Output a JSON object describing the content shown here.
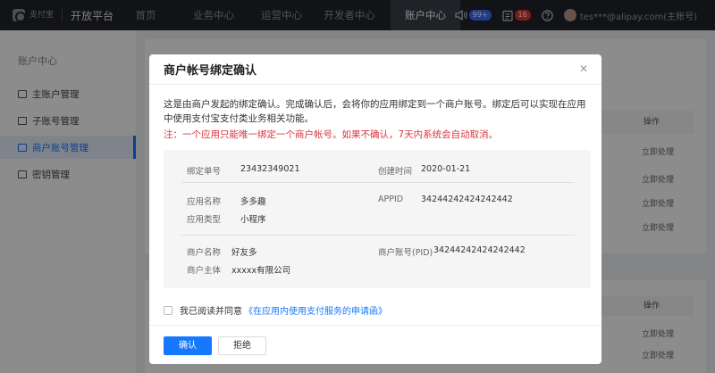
{
  "topbar": {
    "logo_text": "支付宝",
    "platform": "开放平台",
    "nav": [
      "首页",
      "业务中心",
      "运营中心",
      "开发者中心",
      "账户中心"
    ],
    "message_count": "99+",
    "todo_count": "16",
    "account": "tes***@alipay.com(主账号)"
  },
  "sidebar": {
    "title": "账户中心",
    "items": [
      "主账户管理",
      "子账号管理",
      "商户账号管理",
      "密钥管理"
    ]
  },
  "background": {
    "table_header": "操作",
    "row_action": "立即处理"
  },
  "modal": {
    "title": "商户帐号绑定确认",
    "intro": "这是由商户发起的绑定确认。完成确认后，会将你的应用绑定到一个商户账号。绑定后可以实现在应用中使用支付宝支付类业务相关功能。",
    "warning": "注：一个应用只能唯一绑定一个商户帐号。如果不确认，7天内系统会自动取消。",
    "fields": {
      "bind_no_label": "绑定单号",
      "bind_no": "23432349021",
      "created_label": "创建时间",
      "created": "2020-01-21",
      "app_name_label": "应用名称",
      "app_name": "多多趣",
      "appid_label": "APPID",
      "appid": "34244242424242442",
      "app_type_label": "应用类型",
      "app_type": "小程序",
      "merchant_name_label": "商户名称",
      "merchant_name": "好友多",
      "pid_label": "商户账号(PID)",
      "pid": "34244242424242442",
      "merchant_subject_label": "商户主体",
      "merchant_subject": "xxxxx有限公司"
    },
    "agree_text": "我已阅读并同意",
    "agree_link": "《在应用内使用支付服务的申请函》",
    "confirm_label": "确认",
    "reject_label": "拒绝"
  }
}
